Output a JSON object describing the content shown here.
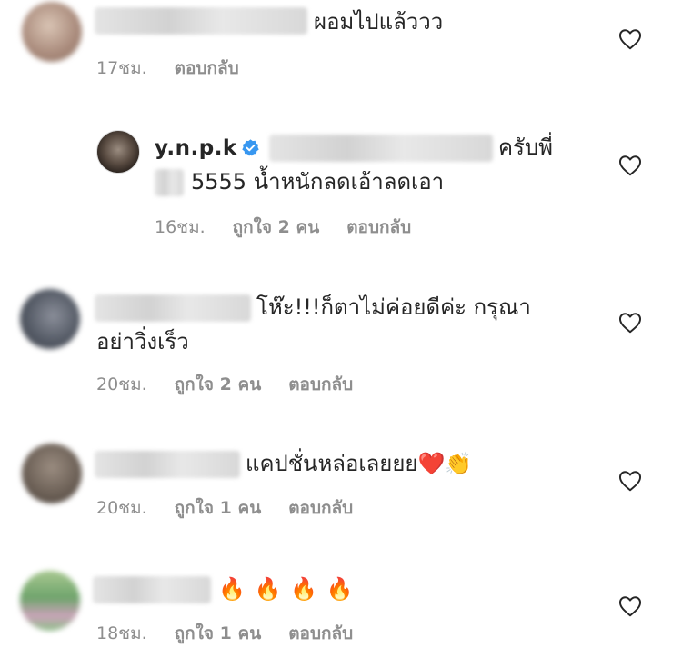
{
  "comments": [
    {
      "text": "ผอมไปแล้ววว",
      "time": "17ชม.",
      "likes": "",
      "reply": "ตอบกลับ",
      "avatar_color": "#b8a090"
    },
    {
      "username": "y.n.p.k",
      "text_line1": "ครับพี่",
      "text_line2": "5555 น้ำหนักลดเอ้าลดเอา",
      "time": "16ชม.",
      "likes": "ถูกใจ 2 คน",
      "reply": "ตอบกลับ",
      "verified": true
    },
    {
      "text_line1": "โห๊ะ!!!ก็ตาไม่ค่อยดีค่ะ  กรุณา",
      "text_line2": "อย่าวิ่งเร็ว",
      "time": "20ชม.",
      "likes": "ถูกใจ 2 คน",
      "reply": "ตอบกลับ",
      "avatar_color": "#5e6470"
    },
    {
      "text": "แคปชั่นหล่อเลยยย",
      "emoji": "❤️👏",
      "time": "20ชม.",
      "likes": "ถูกใจ 1 คน",
      "reply": "ตอบกลับ",
      "avatar_color": "#6e6258"
    },
    {
      "emoji": "🔥 🔥 🔥 🔥",
      "time": "18ชม.",
      "likes": "ถูกใจ 1 คน",
      "reply": "ตอบกลับ",
      "avatar_color": "#7fae7a"
    }
  ],
  "colors": {
    "text": "#262626",
    "meta": "#8e8e8e",
    "verified": "#3897f0"
  },
  "icons": {
    "like": "heart-outline-icon",
    "verified": "verified-badge-icon"
  }
}
